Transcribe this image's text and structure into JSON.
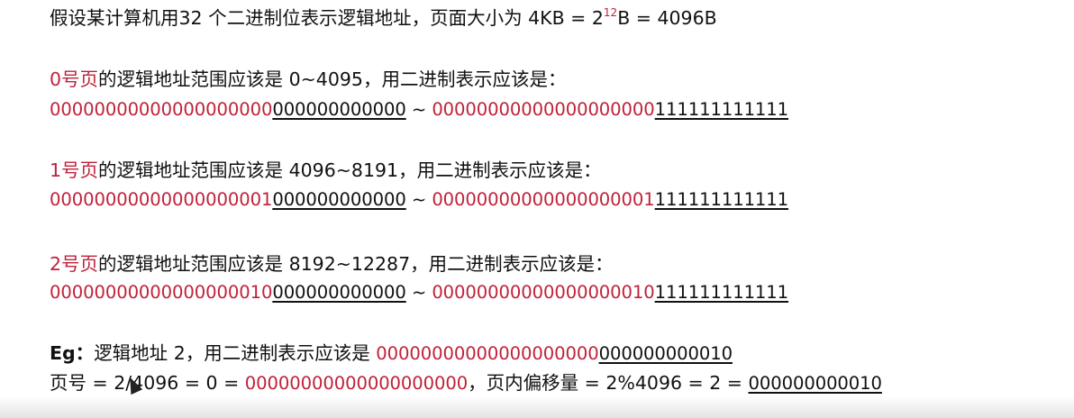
{
  "intro": {
    "text": "假设某计算机用32 个二进制位表示逻辑地址，页面大小为 4KB = 2",
    "exp": "12",
    "rest": "B = 4096B"
  },
  "pages": [
    {
      "label": "0号页",
      "desc": "的逻辑地址范围应该是 0~4095，用二进制表示应该是：",
      "start_hi": "00000000000000000000",
      "start_lo": "000000000000",
      "sep": " ~ ",
      "end_hi": "00000000000000000000",
      "end_lo": "111111111111"
    },
    {
      "label": "1号页",
      "desc": "的逻辑地址范围应该是 4096~8191，用二进制表示应该是：",
      "start_hi": "00000000000000000001",
      "start_lo": "000000000000",
      "sep": " ~ ",
      "end_hi": "00000000000000000001",
      "end_lo": "111111111111"
    },
    {
      "label": "2号页",
      "desc": "的逻辑地址范围应该是 8192~12287，用二进制表示应该是：",
      "start_hi": "00000000000000000010",
      "start_lo": "000000000000",
      "sep": " ~ ",
      "end_hi": "00000000000000000010",
      "end_lo": "111111111111"
    }
  ],
  "example": {
    "prefix": "Eg：",
    "text": "逻辑地址 2，用二进制表示应该是 ",
    "bin_hi": "00000000000000000000",
    "bin_lo": "000000000010"
  },
  "calc": {
    "page_no_text": "页号 = 2/4096 = 0 = ",
    "page_no_bin": "00000000000000000000",
    "offset_text": "，页内偏移量 = 2%4096 = 2 = ",
    "offset_bin": "000000000010"
  },
  "colors": {
    "accent": "#c0223b",
    "text": "#111111"
  }
}
